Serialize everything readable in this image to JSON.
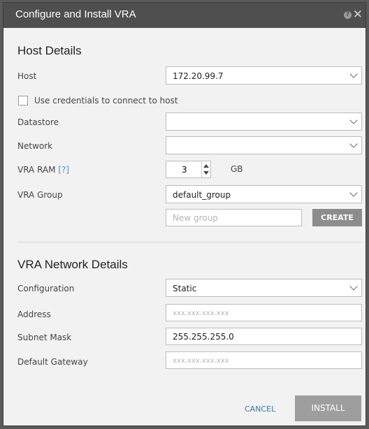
{
  "dialog": {
    "title": "Configure and Install VRA",
    "help_glyph": "?",
    "close_glyph": "✕"
  },
  "host_details": {
    "title": "Host Details",
    "host_label": "Host",
    "host_value": "172.20.99.7",
    "credentials_label": "Use credentials to connect to host",
    "datastore_label": "Datastore",
    "datastore_value": "",
    "network_label": "Network",
    "network_value": "",
    "ram_label": "VRA RAM",
    "ram_help": "[?]",
    "ram_value": "3",
    "ram_unit": "GB",
    "group_label": "VRA Group",
    "group_value": "default_group",
    "new_group_placeholder": "New group",
    "create_label": "CREATE"
  },
  "network_details": {
    "title": "VRA Network Details",
    "configuration_label": "Configuration",
    "configuration_value": "Static",
    "address_label": "Address",
    "address_placeholder": "xxx.xxx.xxx.xxx",
    "subnet_label": "Subnet Mask",
    "subnet_value": "255.255.255.0",
    "gateway_label": "Default Gateway",
    "gateway_placeholder": "xxx.xxx.xxx.xxx"
  },
  "footer": {
    "cancel_label": "CANCEL",
    "install_label": "INSTALL"
  }
}
